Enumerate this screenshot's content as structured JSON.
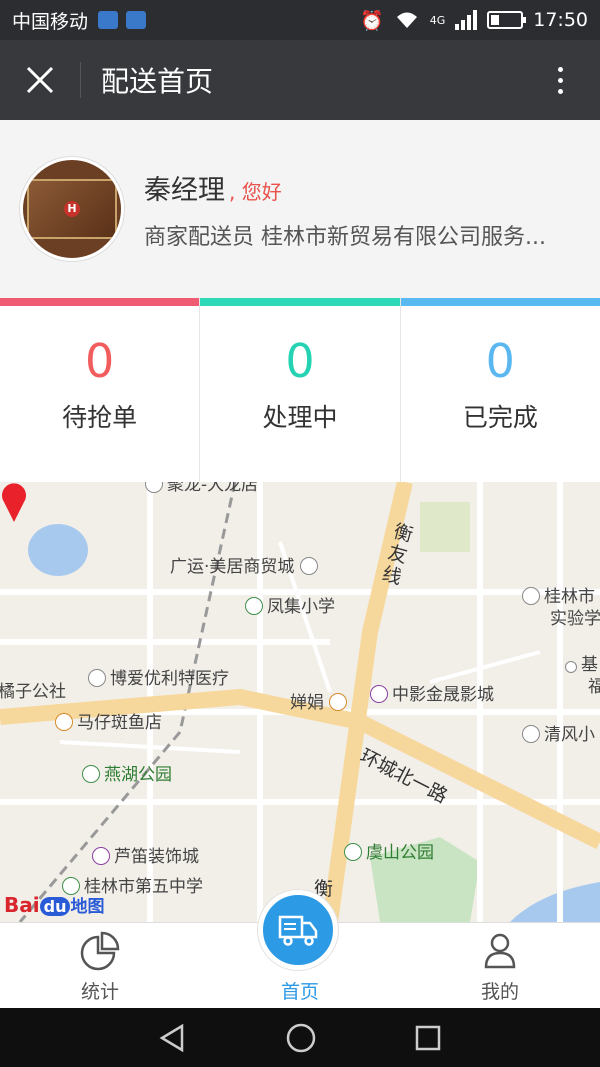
{
  "status_bar": {
    "carrier": "中国移动",
    "network": "4G",
    "time": "17:50"
  },
  "header": {
    "title": "配送首页"
  },
  "profile": {
    "name": "秦经理",
    "greeting": ", 您好",
    "role_line": "商家配送员 桂林市新贸易有限公司服务..."
  },
  "stats": [
    {
      "value": "0",
      "label": "待抢单",
      "color": "#f15c5c",
      "bar_color": "#ee5b72"
    },
    {
      "value": "0",
      "label": "处理中",
      "color": "#25d3b3",
      "bar_color": "#2fd8b6"
    },
    {
      "value": "0",
      "label": "已完成",
      "color": "#5ab7ef",
      "bar_color": "#5bb9f2"
    }
  ],
  "map": {
    "labels": {
      "longhao": "聚龙-大龙店",
      "guangyun": "广运·美居商贸城",
      "fengji": "凤集小学",
      "hengyou": "衡友线",
      "guilin_shi": "桂林市",
      "shiyan": "实验学",
      "ji": "基",
      "fu": "福",
      "juzi": "橘子公社",
      "boai": "博爱优利特医疗",
      "chanjuan": "婵娟",
      "zhongying": "中影金晟影城",
      "mazai": "马仔斑鱼店",
      "huancheng": "环城北一路",
      "qingfeng": "清风小",
      "yanhu": "燕湖公园",
      "ludi": "芦笛装饰城",
      "yushan": "虞山公园",
      "wuzhong": "桂林市第五中学",
      "heng": "衡",
      "baidu": "Bai",
      "baidu_du": "du",
      "baidu_map": "地图"
    }
  },
  "tabs": [
    {
      "label": "统计"
    },
    {
      "label": "首页"
    },
    {
      "label": "我的"
    }
  ]
}
